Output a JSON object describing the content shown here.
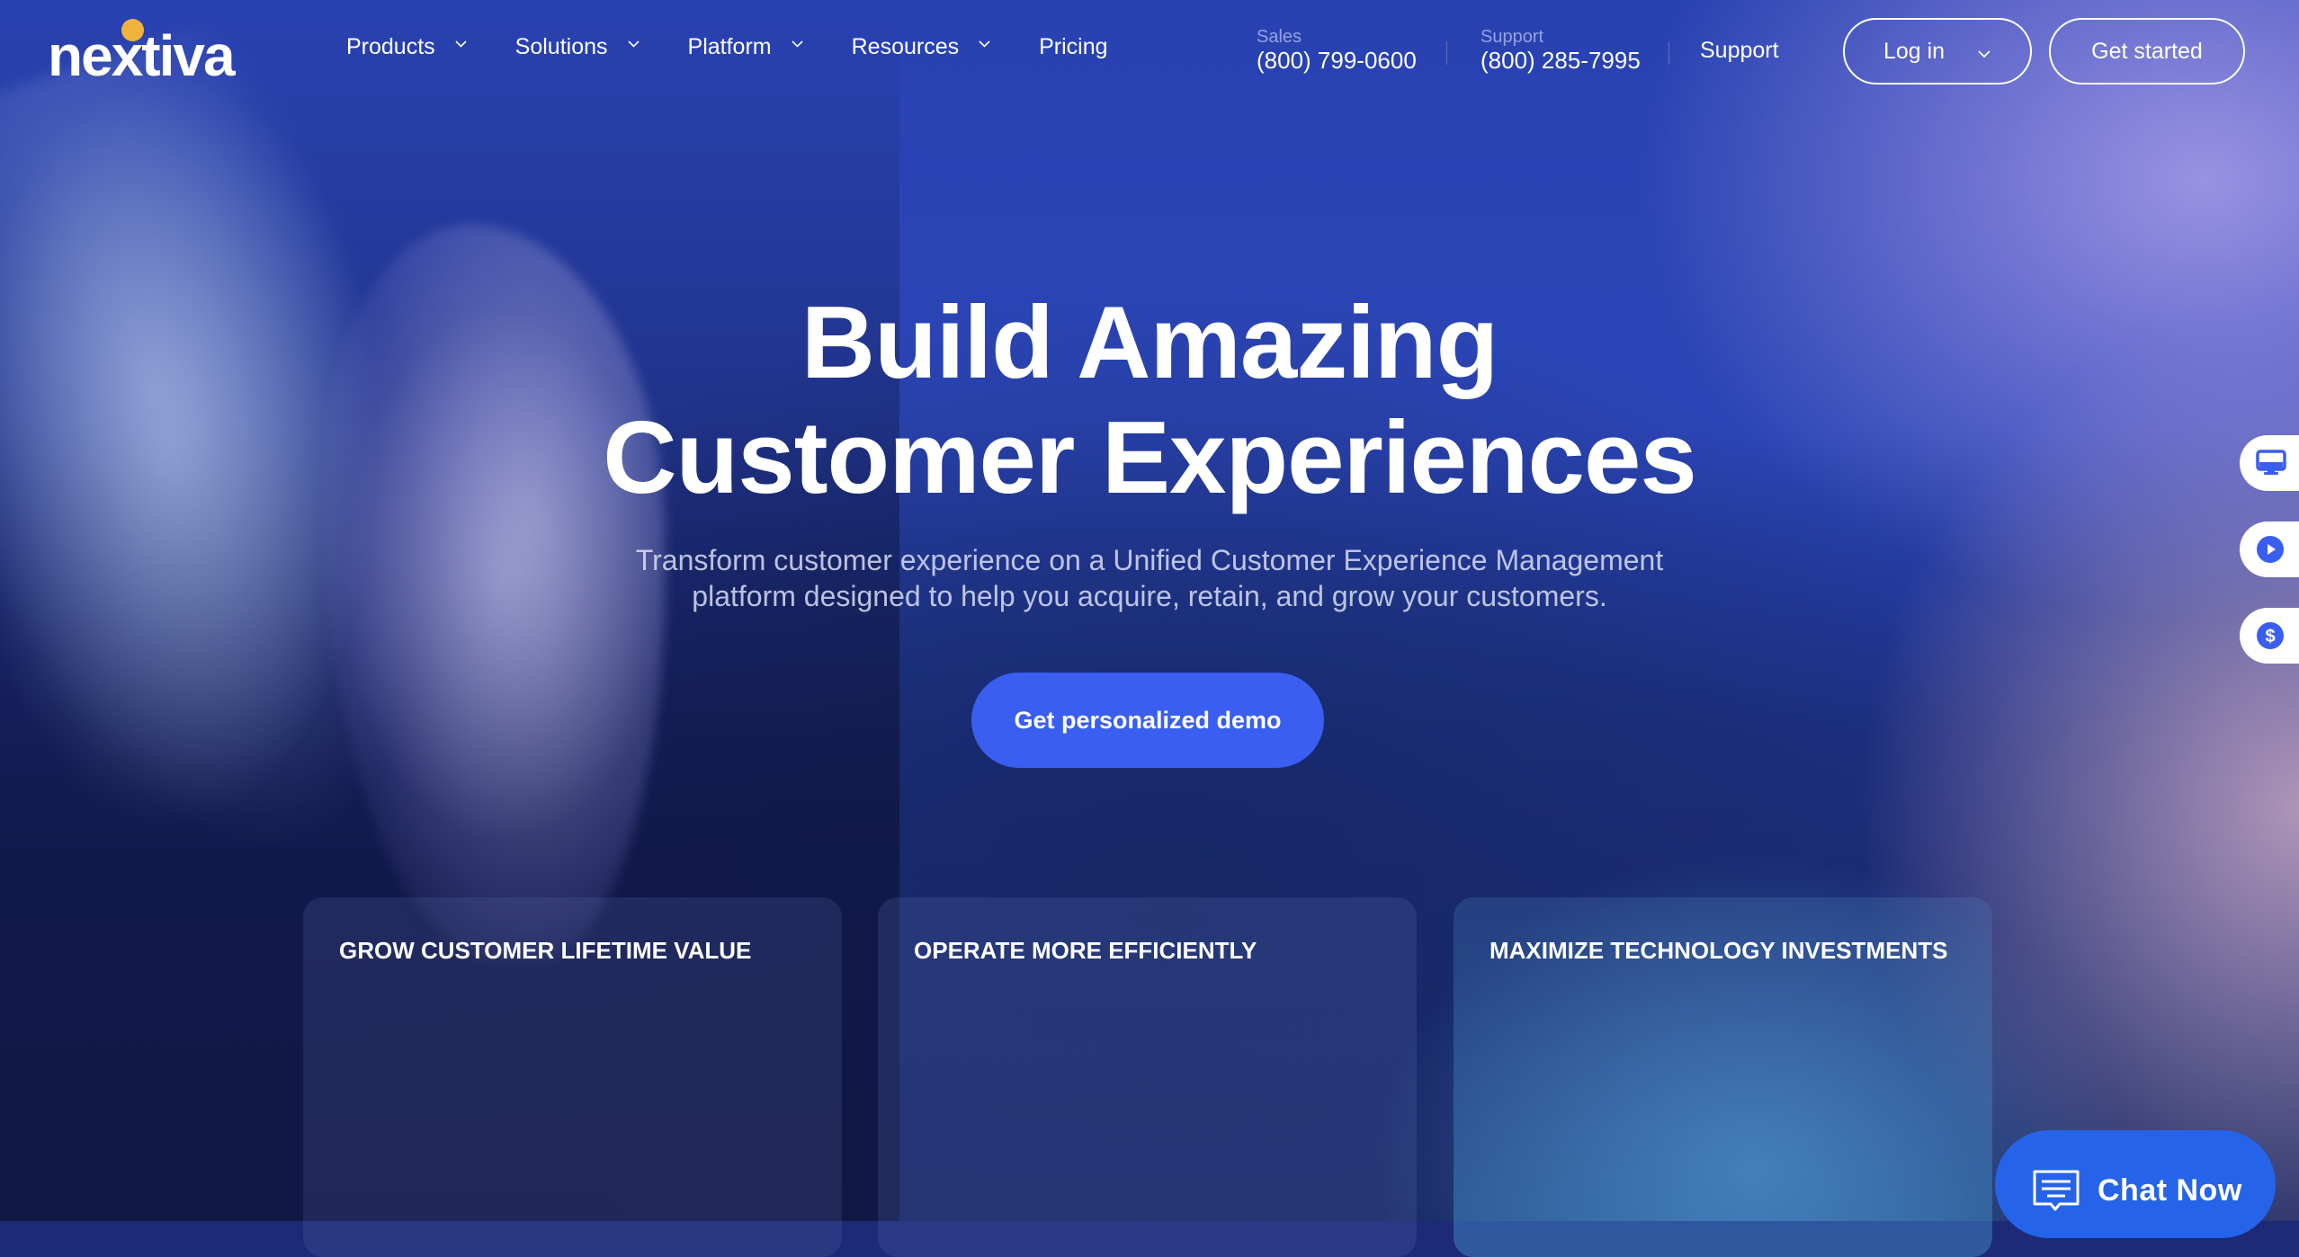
{
  "colors": {
    "accent_blue": "#3a5ef0",
    "chat_blue": "#2563e8",
    "logo_dot": "#f2b33d",
    "side_icon_blue": "#3a5ef0"
  },
  "header": {
    "logo": {
      "text": "nextiva"
    },
    "nav": [
      {
        "label": "Products",
        "has_dropdown": true
      },
      {
        "label": "Solutions",
        "has_dropdown": true
      },
      {
        "label": "Platform",
        "has_dropdown": true
      },
      {
        "label": "Resources",
        "has_dropdown": true
      },
      {
        "label": "Pricing",
        "has_dropdown": false
      }
    ],
    "contacts": [
      {
        "label": "Sales",
        "phone": "(800) 799-0600"
      },
      {
        "label": "Support",
        "phone": "(800) 285-7995"
      }
    ],
    "support_link": "Support",
    "login_label": "Log in",
    "get_started_label": "Get started"
  },
  "hero": {
    "title_line1": "Build Amazing",
    "title_line2": "Customer Experiences",
    "subtitle_line1": "Transform customer experience on a Unified Customer Experience Management",
    "subtitle_line2": "platform designed to help you acquire, retain, and grow your customers.",
    "cta_label": "Get personalized demo"
  },
  "cards": [
    {
      "title": "GROW CUSTOMER LIFETIME VALUE"
    },
    {
      "title": "OPERATE MORE EFFICIENTLY"
    },
    {
      "title": "MAXIMIZE TECHNOLOGY INVESTMENTS"
    }
  ],
  "side_tabs": [
    {
      "icon": "monitor-icon"
    },
    {
      "icon": "play-circle-icon"
    },
    {
      "icon": "dollar-circle-icon"
    }
  ],
  "chat": {
    "label": "Chat Now",
    "icon": "chat-bubble-icon"
  }
}
